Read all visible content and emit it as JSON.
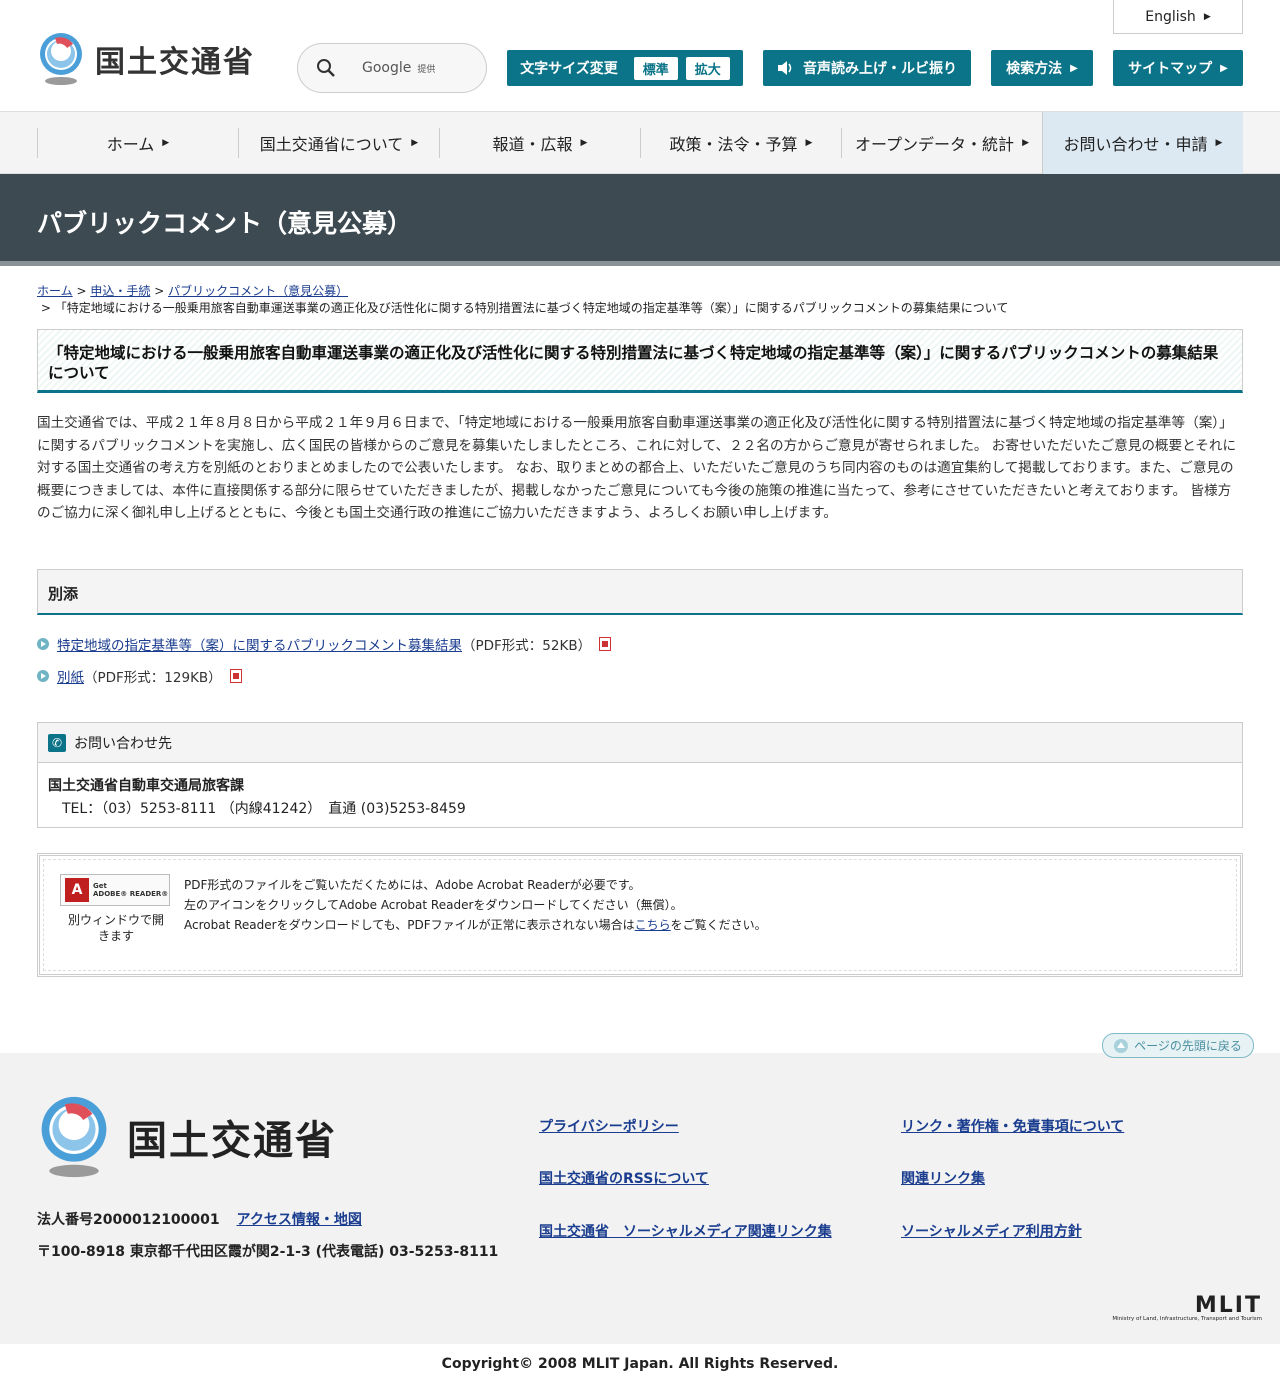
{
  "header": {
    "logo_text": "国土交通省",
    "english_label": "English",
    "search": {
      "label": "Google",
      "sub": "提供"
    },
    "font_size": {
      "label": "文字サイズ変更",
      "normal": "標準",
      "large": "拡大"
    },
    "voice_label": "音声読み上げ・ルビ振り",
    "search_method_label": "検索方法",
    "sitemap_label": "サイトマップ",
    "accent_color": "#0c7488"
  },
  "gnav": [
    {
      "label": "ホーム"
    },
    {
      "label": "国土交通省について"
    },
    {
      "label": "報道・広報"
    },
    {
      "label": "政策・法令・予算"
    },
    {
      "label": "オープンデータ・統計"
    },
    {
      "label": "お問い合わせ・申請"
    }
  ],
  "page_title": "パブリックコメント（意見公募）",
  "breadcrumb": {
    "home": "ホーム",
    "apply": "申込・手続",
    "pubcom": "パブリックコメント（意見公募）",
    "current": "「特定地域における一般乗用旅客自動車運送事業の適正化及び活性化に関する特別措置法に基づく特定地域の指定基準等（案）」に関するパブリックコメントの募集結果について"
  },
  "article": {
    "heading": "「特定地域における一般乗用旅客自動車運送事業の適正化及び活性化に関する特別措置法に基づく特定地域の指定基準等（案）」に関するパブリックコメントの募集結果について",
    "body": "国土交通省では、平成２１年８月８日から平成２１年９月６日まで、「特定地域における一般乗用旅客自動車運送事業の適正化及び活性化に関する特別措置法に基づく特定地域の指定基準等（案）」に関するパブリックコメントを実施し、広く国民の皆様からのご意見を募集いたしましたところ、これに対して、２２名の方からご意見が寄せられました。 お寄せいただいたご意見の概要とそれに対する国土交通省の考え方を別紙のとおりまとめましたので公表いたします。 なお、取りまとめの都合上、いただいたご意見のうち同内容のものは適宜集約して掲載しております。また、ご意見の概要につきましては、本件に直接関係する部分に限らせていただきましたが、掲載しなかったご意見についても今後の施策の推進に当たって、参考にさせていただきたいと考えております。 皆様方のご協力に深く御礼申し上げるとともに、今後とも国土交通行政の推進にご協力いただきますよう、よろしくお願い申し上げます。"
  },
  "attachments": {
    "heading": "別添",
    "items": [
      {
        "link": "特定地域の指定基準等（案）に関するパブリックコメント募集結果",
        "meta": "（PDF形式：52KB）"
      },
      {
        "link": "別紙",
        "meta": "（PDF形式：129KB）"
      }
    ]
  },
  "contact": {
    "heading": "お問い合わせ先",
    "org": "国土交通省自動車交通局旅客課",
    "tel": "TEL：（03）5253-8111 （内線41242）　直通 (03)5253-8459"
  },
  "adobe": {
    "badge_line1": "Get",
    "badge_line2": "ADOBE® READER®",
    "caption": "別ウィンドウで開きます",
    "line1": "PDF形式のファイルをご覧いただくためには、Adobe Acrobat Readerが必要です。",
    "line2": "左のアイコンをクリックしてAdobe Acrobat Readerをダウンロードしてください（無償）。",
    "line3_pre": "Acrobat Readerをダウンロードしても、PDFファイルが正常に表示されない場合は",
    "line3_link": "こちら",
    "line3_post": "をご覧ください。"
  },
  "pagetop_label": "ページの先頭に戻る",
  "footer": {
    "logo_text": "国土交通省",
    "corp_number": "法人番号2000012100001",
    "access_link": "アクセス情報・地図",
    "address": "〒100-8918 東京都千代田区霞が関2-1-3 (代表電話) 03-5253-8111",
    "links": [
      "プライバシーポリシー",
      "リンク・著作権・免責事項について",
      "国土交通省のRSSについて",
      "関連リンク集",
      "国土交通省　ソーシャルメディア関連リンク集",
      "ソーシャルメディア利用方針"
    ],
    "mlit_logo": "MLIT",
    "mlit_sub": "Ministry of Land, Infrastructure, Transport and Tourism",
    "copyright": "Copyright© 2008 MLIT Japan. All Rights Reserved."
  }
}
